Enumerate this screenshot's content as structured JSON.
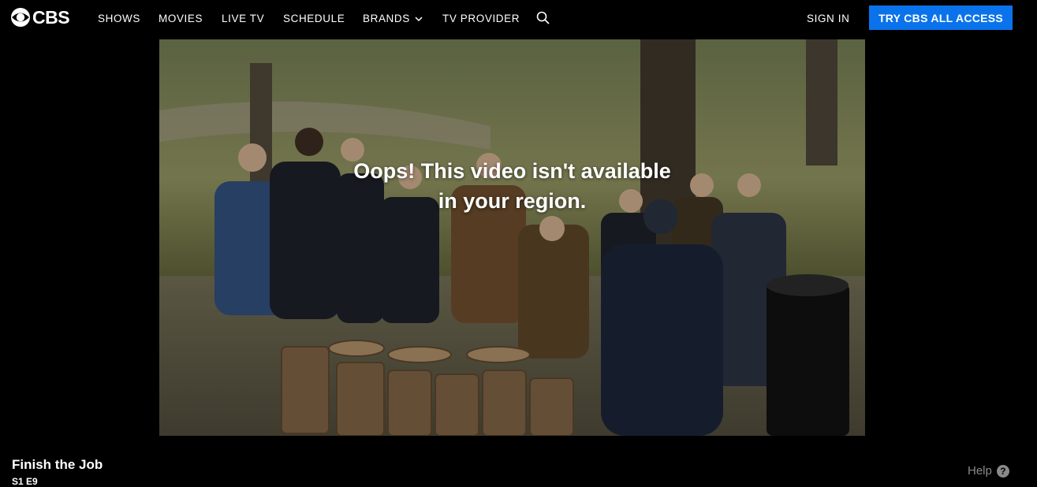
{
  "brand": {
    "name": "CBS",
    "cta_color": "#0a73eb"
  },
  "nav": {
    "items": [
      {
        "label": "SHOWS"
      },
      {
        "label": "MOVIES"
      },
      {
        "label": "LIVE TV"
      },
      {
        "label": "SCHEDULE"
      },
      {
        "label": "BRANDS"
      },
      {
        "label": "TV PROVIDER"
      }
    ],
    "search_icon": "search-icon",
    "sign_in": "SIGN IN",
    "cta": "TRY CBS ALL ACCESS"
  },
  "player": {
    "message_line1": "Oops! This video isn't available",
    "message_line2": "in your region."
  },
  "episode": {
    "title": "Finish the Job",
    "number": "S1 E9"
  },
  "footer": {
    "help": "Help",
    "help_icon": "question-circle-icon"
  }
}
